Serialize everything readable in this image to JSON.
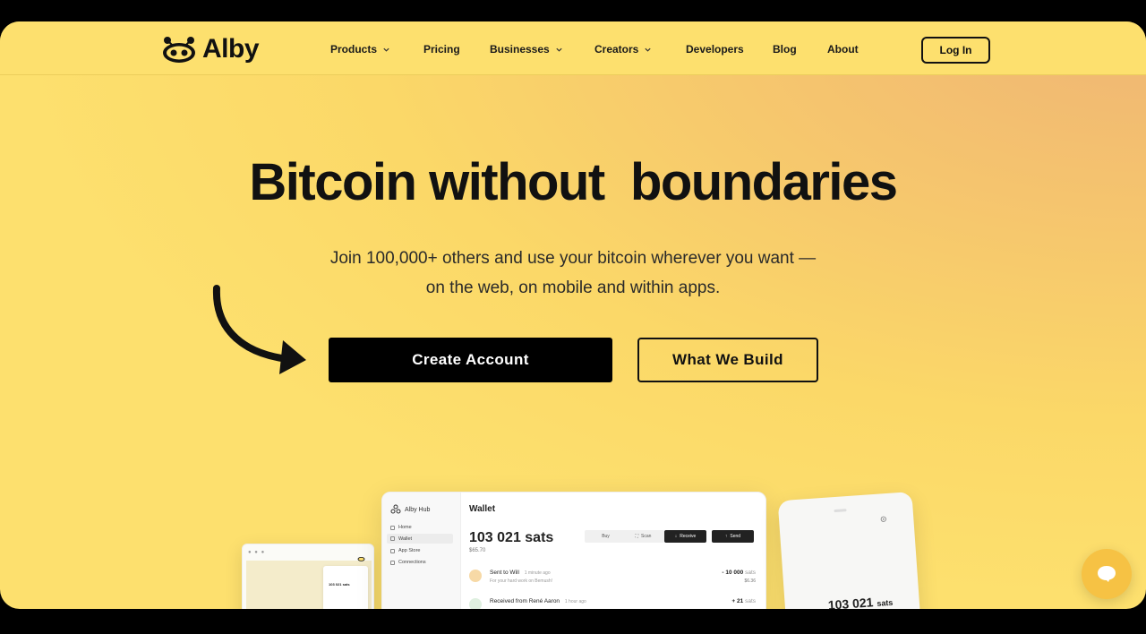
{
  "brand": {
    "name": "Alby"
  },
  "nav": {
    "items": [
      {
        "label": "Products",
        "dropdown": true
      },
      {
        "label": "Pricing",
        "dropdown": false
      },
      {
        "label": "Businesses",
        "dropdown": true
      },
      {
        "label": "Creators",
        "dropdown": true
      },
      {
        "label": "Developers",
        "dropdown": false
      },
      {
        "label": "Blog",
        "dropdown": false
      },
      {
        "label": "About",
        "dropdown": false
      }
    ],
    "login_label": "Log In"
  },
  "hero": {
    "title": "Bitcoin without  boundaries",
    "subtitle_line1": "Join 100,000+ others and use your bitcoin wherever you want —",
    "subtitle_line2": "on the web, on mobile and within apps.",
    "primary_cta": "Create Account",
    "secondary_cta": "What We Build"
  },
  "small_device": {
    "balance": "103 021 sats"
  },
  "hub": {
    "app_name": "Alby Hub",
    "sidebar": [
      "Home",
      "Wallet",
      "App Store",
      "Connections"
    ],
    "page_title": "Wallet",
    "balance": "103 021 sats",
    "fiat": "$65.70",
    "actions": [
      "Buy",
      "Scan",
      "Receive",
      "Send"
    ],
    "transactions": [
      {
        "title": "Sent to",
        "name": "Will",
        "time": "1 minute ago",
        "memo": "For your hard work on Bemush!",
        "amount": "- 10 000",
        "unit": "sats",
        "fiat": "$6.36"
      },
      {
        "title": "Received from",
        "name": "René Aaron",
        "time": "1 hour ago",
        "memo": "",
        "amount": "+ 21",
        "unit": "sats",
        "fiat": ""
      }
    ]
  },
  "phone": {
    "balance": "103 021",
    "unit": "sats"
  },
  "colors": {
    "background": "#fde06e",
    "accent_dark": "#000000",
    "chat": "#f6c244"
  }
}
